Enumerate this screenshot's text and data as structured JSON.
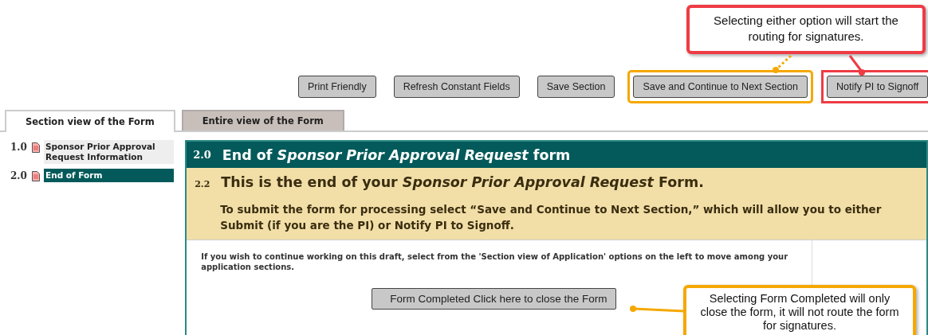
{
  "toolbar": {
    "buttons": [
      {
        "label": "Print Friendly"
      },
      {
        "label": "Refresh Constant Fields"
      },
      {
        "label": "Save Section"
      },
      {
        "label": "Save and Continue to Next Section",
        "color": "#f5a800"
      },
      {
        "label": "Notify PI to Signoff",
        "color": "#ee3b44"
      }
    ]
  },
  "tabs": [
    {
      "label": "Section view of the Form",
      "selected": true
    },
    {
      "label": "Entire view of the Form",
      "selected": false
    }
  ],
  "sidebar": {
    "items": [
      {
        "number": "1.0",
        "title": "Sponsor Prior Approval Request Information",
        "selected": false
      },
      {
        "number": "2.0",
        "title": "End of Form",
        "selected": true
      }
    ]
  },
  "section": {
    "number": "2.0",
    "title": "End of *Sponsor Prior Approval Request* form",
    "subsection": {
      "number": "2.2",
      "heading": "This is the end of your *Sponsor Prior Approval Request* Form.",
      "text": "To submit the form for processing select “Save and Continue to Next Section,” which will allow you to either Submit (if you are the PI) or Notify PI to Signoff."
    },
    "note": "If you wish to continue working on this draft, select from the 'Section view of Application' options on the left to move among your application sections.",
    "close_button": "Form Completed  Click here to close the Form"
  },
  "callouts": [
    {
      "text": "Selecting either option will start the routing for signatures.",
      "color": "#ee3b44"
    },
    {
      "text": "Selecting Form Completed will only close the form, it will not route the form for signatures.",
      "color": "#f5a800"
    }
  ]
}
